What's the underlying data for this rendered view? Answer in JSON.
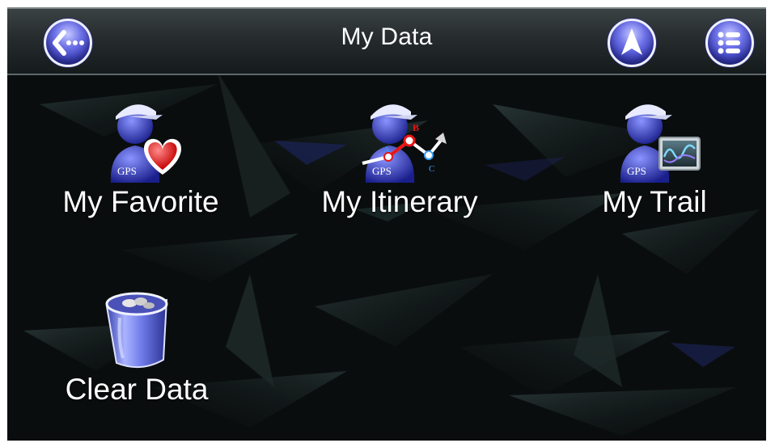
{
  "header": {
    "title": "My Data",
    "back_icon": "back-arrow-icon",
    "navigate_icon": "navigation-arrow-icon",
    "menu_icon": "list-menu-icon"
  },
  "items": [
    {
      "label": "My Favorite",
      "icon": "gps-user-heart-icon"
    },
    {
      "label": "My Itinerary",
      "icon": "gps-user-route-icon",
      "route_marks": [
        "A",
        "B",
        "C"
      ]
    },
    {
      "label": "My Trail",
      "icon": "gps-user-trail-icon"
    },
    {
      "label": "Clear Data",
      "icon": "trash-bin-icon"
    }
  ],
  "gps_badge": "GPS",
  "colors": {
    "button_blue": "#4a4fd6",
    "background": "#0b0e0f",
    "heart": "#e81515"
  }
}
